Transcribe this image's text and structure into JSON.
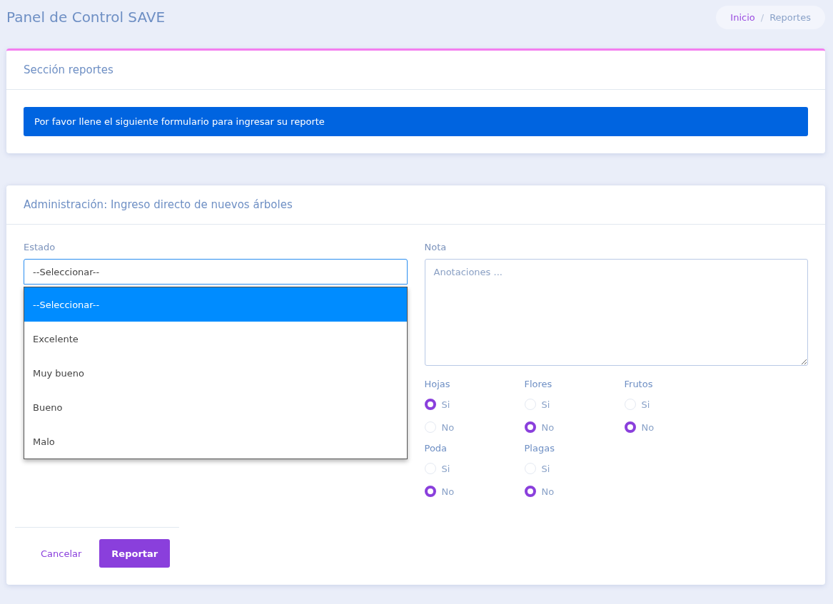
{
  "header": {
    "title": "Panel de Control SAVE",
    "breadcrumb_separator": "/",
    "breadcrumb": [
      {
        "label": "Inicio",
        "kind": "link"
      },
      {
        "label": "Reportes",
        "kind": "current"
      }
    ]
  },
  "intro_card": {
    "title": "Sección reportes",
    "alert": "Por favor llene el siguiente formulario para ingresar su reporte"
  },
  "form_card": {
    "title": "Administración: Ingreso directo de nuevos árboles",
    "estado": {
      "label": "Estado",
      "value": "--Seleccionar--",
      "expanded": true,
      "options": [
        {
          "label": "--Seleccionar--",
          "selected": true
        },
        {
          "label": "Excelente",
          "selected": false
        },
        {
          "label": "Muy bueno",
          "selected": false
        },
        {
          "label": "Bueno",
          "selected": false
        },
        {
          "label": "Malo",
          "selected": false
        }
      ]
    },
    "nota": {
      "label": "Nota",
      "placeholder": "Anotaciones ..."
    },
    "radio_groups": [
      {
        "label": "Hojas",
        "options": [
          {
            "label": "Si",
            "selected": true
          },
          {
            "label": "No",
            "selected": false
          }
        ]
      },
      {
        "label": "Flores",
        "options": [
          {
            "label": "Si",
            "selected": false
          },
          {
            "label": "No",
            "selected": true
          }
        ]
      },
      {
        "label": "Frutos",
        "options": [
          {
            "label": "Si",
            "selected": false
          },
          {
            "label": "No",
            "selected": true
          }
        ]
      },
      {
        "label": "Poda",
        "options": [
          {
            "label": "Si",
            "selected": false
          },
          {
            "label": "No",
            "selected": true
          }
        ]
      },
      {
        "label": "Plagas",
        "options": [
          {
            "label": "Si",
            "selected": false
          },
          {
            "label": "No",
            "selected": true
          }
        ]
      }
    ],
    "buttons": [
      {
        "label": "Cancelar",
        "kind": "link"
      },
      {
        "label": "Reportar",
        "kind": "primary"
      }
    ]
  }
}
